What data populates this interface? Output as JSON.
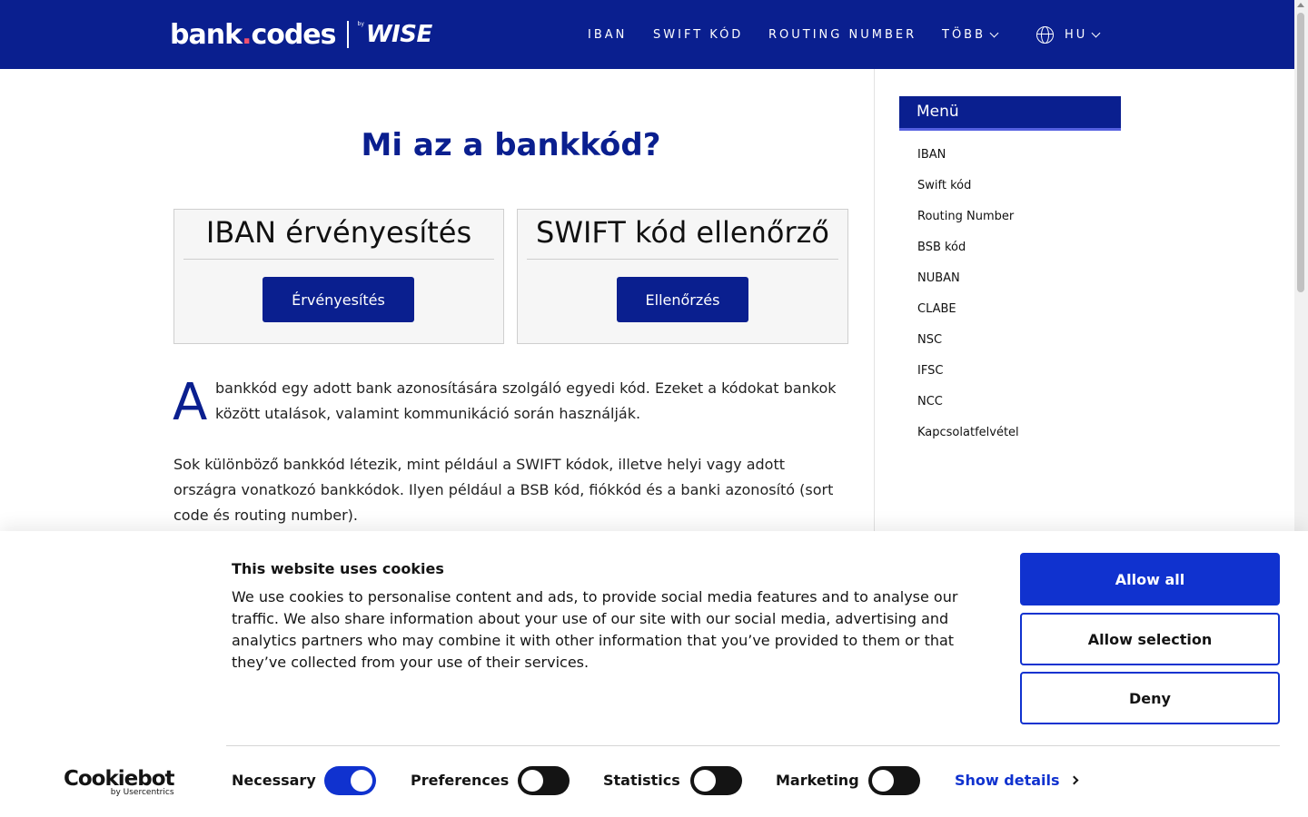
{
  "header": {
    "logo_bank": "bank",
    "logo_dot": ".",
    "logo_codes": "codes",
    "logo_by": "by",
    "logo_wise": "WISE",
    "nav": {
      "iban": "IBAN",
      "swift": "SWIFT KÓD",
      "routing": "ROUTING NUMBER",
      "more": "TÖBB",
      "lang": "HU"
    }
  },
  "main": {
    "title": "Mi az a bankkód?",
    "cards": [
      {
        "title": "IBAN érvényesítés",
        "button": "Érvényesítés"
      },
      {
        "title": "SWIFT kód ellenőrző",
        "button": "Ellenőrzés"
      }
    ],
    "dropcap": "A",
    "para1": "bankkód egy adott bank azonosítására szolgáló egyedi kód. Ezeket a kódokat bankok között utalások, valamint kommunikáció során használják.",
    "para2": "Sok különböző bankkód létezik, mint például a SWIFT kódok, illetve helyi vagy adott országra vonatkozó bankkódok. Ilyen például a BSB kód, fiókkód és a banki azonosító (sort code és routing number)."
  },
  "sidebar": {
    "heading": "Menü",
    "items": [
      "IBAN",
      "Swift kód",
      "Routing Number",
      "BSB kód",
      "NUBAN",
      "CLABE",
      "NSC",
      "IFSC",
      "NCC",
      "Kapcsolatfelvétel"
    ]
  },
  "cookie": {
    "title": "This website uses cookies",
    "text": "We use cookies to personalise content and ads, to provide social media features and to analyse our traffic. We also share information about your use of our site with our social media, advertising and analytics partners who may combine it with other information that you’ve provided to them or that they’ve collected from your use of their services.",
    "allow_all": "Allow all",
    "allow_selection": "Allow selection",
    "deny": "Deny",
    "logo_main": "Cookiebot",
    "logo_sub": "by Usercentrics",
    "toggles": [
      {
        "label": "Necessary",
        "state": "on"
      },
      {
        "label": "Preferences",
        "state": "off"
      },
      {
        "label": "Statistics",
        "state": "off"
      },
      {
        "label": "Marketing",
        "state": "off"
      }
    ],
    "show_details": "Show details"
  },
  "colors": {
    "brand_navy": "#0a1f8f",
    "cookie_blue": "#1032cf",
    "logo_dot": "#f0506e"
  }
}
